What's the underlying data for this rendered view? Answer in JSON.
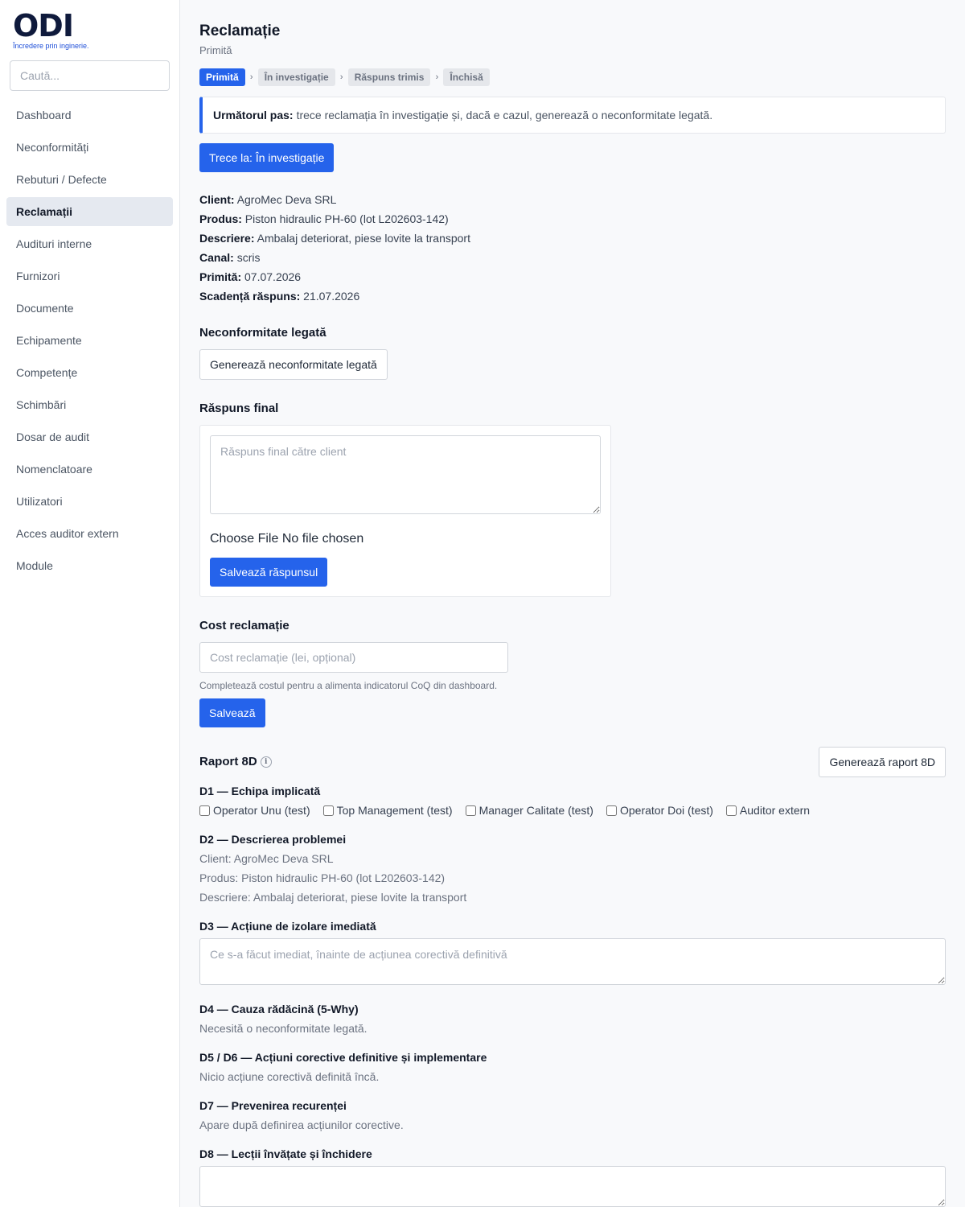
{
  "brand": {
    "logo_text": "ODI",
    "tagline": "Încredere prin inginerie."
  },
  "search": {
    "placeholder": "Caută..."
  },
  "sidebar": {
    "items": [
      {
        "label": "Dashboard"
      },
      {
        "label": "Neconformități"
      },
      {
        "label": "Rebuturi / Defecte"
      },
      {
        "label": "Reclamații",
        "active": true
      },
      {
        "label": "Audituri interne"
      },
      {
        "label": "Furnizori"
      },
      {
        "label": "Documente"
      },
      {
        "label": "Echipamente"
      },
      {
        "label": "Competențe"
      },
      {
        "label": "Schimbări"
      },
      {
        "label": "Dosar de audit"
      },
      {
        "label": "Nomenclatoare"
      },
      {
        "label": "Utilizatori"
      },
      {
        "label": "Acces auditor extern"
      },
      {
        "label": "Module"
      }
    ]
  },
  "page": {
    "title": "Reclamație",
    "status": "Primită"
  },
  "workflow": {
    "steps": [
      {
        "label": "Primită",
        "active": true
      },
      {
        "label": "În investigație"
      },
      {
        "label": "Răspuns trimis"
      },
      {
        "label": "Închisă"
      }
    ],
    "separator": "›"
  },
  "next_step": {
    "label": "Următorul pas:",
    "text": "trece reclamația în investigație și, dacă e cazul, generează o neconformitate legată."
  },
  "transition_button": "Trece la: În investigație",
  "details": {
    "client": {
      "label": "Client:",
      "value": "AgroMec Deva SRL"
    },
    "produs": {
      "label": "Produs:",
      "value": "Piston hidraulic PH-60 (lot L202603-142)"
    },
    "descriere": {
      "label": "Descriere:",
      "value": "Ambalaj deteriorat, piese lovite la transport"
    },
    "canal": {
      "label": "Canal:",
      "value": "scris"
    },
    "primita": {
      "label": "Primită:",
      "value": "07.07.2026"
    },
    "scadenta": {
      "label": "Scadență răspuns:",
      "value": "21.07.2026"
    }
  },
  "linked_nc": {
    "title": "Neconformitate legată",
    "button": "Generează neconformitate legată"
  },
  "final_response": {
    "title": "Răspuns final",
    "placeholder": "Răspuns final către client",
    "file_text": "Choose File No file chosen",
    "save_button": "Salvează răspunsul"
  },
  "cost": {
    "title": "Cost reclamație",
    "placeholder": "Cost reclamație (lei, opțional)",
    "hint": "Completează costul pentru a alimenta indicatorul CoQ din dashboard.",
    "save_button": "Salvează"
  },
  "report8d": {
    "title": "Raport 8D",
    "info_glyph": "i",
    "generate_button": "Generează raport 8D",
    "d1": {
      "title": "D1 — Echipa implicată",
      "members": [
        "Operator Unu (test)",
        "Top Management (test)",
        "Manager Calitate (test)",
        "Operator Doi (test)",
        "Auditor extern"
      ]
    },
    "d2": {
      "title": "D2 — Descrierea problemei",
      "lines": [
        "Client: AgroMec Deva SRL",
        "Produs: Piston hidraulic PH-60 (lot L202603-142)",
        "Descriere: Ambalaj deteriorat, piese lovite la transport"
      ]
    },
    "d3": {
      "title": "D3 — Acțiune de izolare imediată",
      "placeholder": "Ce s-a făcut imediat, înainte de acțiunea corectivă definitivă"
    },
    "d4": {
      "title": "D4 — Cauza rădăcină (5-Why)",
      "text": "Necesită o neconformitate legată."
    },
    "d56": {
      "title": "D5 / D6 — Acțiuni corective definitive și implementare",
      "text": "Nicio acțiune corectivă definită încă."
    },
    "d7": {
      "title": "D7 — Prevenirea recurenței",
      "text": "Apare după definirea acțiunilor corective."
    },
    "d8": {
      "title": "D8 — Lecții învățate și închidere"
    }
  }
}
